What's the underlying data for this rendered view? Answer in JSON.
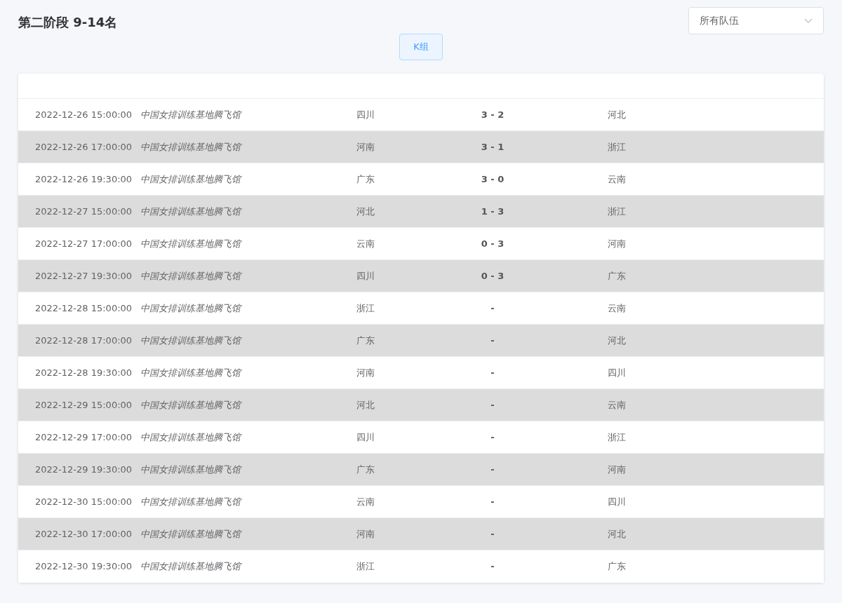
{
  "title": "第二阶段 9-14名",
  "team_filter": {
    "value": "所有队伍"
  },
  "group_tabs": [
    {
      "label": "K组",
      "selected": true
    }
  ],
  "matches": [
    {
      "time": "2022-12-26 15:00:00",
      "venue": "中国女排训练基地腾飞馆",
      "home": "四川",
      "score": "3 - 2",
      "away": "河北"
    },
    {
      "time": "2022-12-26 17:00:00",
      "venue": "中国女排训练基地腾飞馆",
      "home": "河南",
      "score": "3 - 1",
      "away": "浙江"
    },
    {
      "time": "2022-12-26 19:30:00",
      "venue": "中国女排训练基地腾飞馆",
      "home": "广东",
      "score": "3 - 0",
      "away": "云南"
    },
    {
      "time": "2022-12-27 15:00:00",
      "venue": "中国女排训练基地腾飞馆",
      "home": "河北",
      "score": "1 - 3",
      "away": "浙江"
    },
    {
      "time": "2022-12-27 17:00:00",
      "venue": "中国女排训练基地腾飞馆",
      "home": "云南",
      "score": "0 - 3",
      "away": "河南"
    },
    {
      "time": "2022-12-27 19:30:00",
      "venue": "中国女排训练基地腾飞馆",
      "home": "四川",
      "score": "0 - 3",
      "away": "广东"
    },
    {
      "time": "2022-12-28 15:00:00",
      "venue": "中国女排训练基地腾飞馆",
      "home": "浙江",
      "score": "-",
      "away": "云南"
    },
    {
      "time": "2022-12-28 17:00:00",
      "venue": "中国女排训练基地腾飞馆",
      "home": "广东",
      "score": "-",
      "away": "河北"
    },
    {
      "time": "2022-12-28 19:30:00",
      "venue": "中国女排训练基地腾飞馆",
      "home": "河南",
      "score": "-",
      "away": "四川"
    },
    {
      "time": "2022-12-29 15:00:00",
      "venue": "中国女排训练基地腾飞馆",
      "home": "河北",
      "score": "-",
      "away": "云南"
    },
    {
      "time": "2022-12-29 17:00:00",
      "venue": "中国女排训练基地腾飞馆",
      "home": "四川",
      "score": "-",
      "away": "浙江"
    },
    {
      "time": "2022-12-29 19:30:00",
      "venue": "中国女排训练基地腾飞馆",
      "home": "广东",
      "score": "-",
      "away": "河南"
    },
    {
      "time": "2022-12-30 15:00:00",
      "venue": "中国女排训练基地腾飞馆",
      "home": "云南",
      "score": "-",
      "away": "四川"
    },
    {
      "time": "2022-12-30 17:00:00",
      "venue": "中国女排训练基地腾飞馆",
      "home": "河南",
      "score": "-",
      "away": "河北"
    },
    {
      "time": "2022-12-30 19:30:00",
      "venue": "中国女排训练基地腾飞馆",
      "home": "浙江",
      "score": "-",
      "away": "广东"
    }
  ]
}
